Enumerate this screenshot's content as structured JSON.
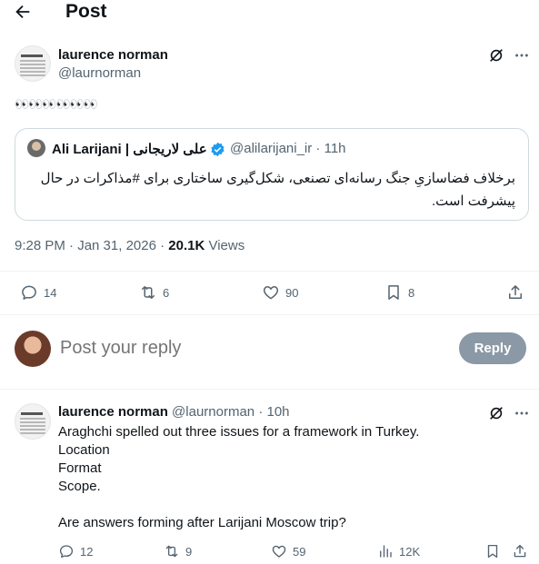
{
  "header": {
    "title": "Post"
  },
  "post": {
    "author_name": "laurence norman",
    "author_handle": "@laurnorman",
    "emoji_text": "👀👀👀👀👀👀",
    "quote": {
      "author_name": "Ali Larijani | علی لاریجانی",
      "author_handle": "@alilarijani_ir · 11h",
      "text": "برخلاف فضاسازیِ جنگ رسانه‌ای تصنعی، شکل‌گیری ساختاری برای #مذاکرات در حال پیشرفت است."
    },
    "timestamp": "9:28 PM · Jan 31, 2026 · ",
    "views_count": "20.1K",
    "views_label": " Views",
    "actions": {
      "replies": "14",
      "reposts": "6",
      "likes": "90",
      "bookmarks": "8"
    }
  },
  "composer": {
    "placeholder": "Post your reply",
    "button_label": "Reply"
  },
  "reply_post": {
    "author_name": "laurence norman",
    "author_handle": "@laurnorman · 10h",
    "lines": [
      "Araghchi spelled out three issues for a framework in Turkey.",
      "Location",
      "Format",
      "Scope.",
      "",
      "Are answers forming after Larijani Moscow trip?"
    ],
    "actions": {
      "replies": "12",
      "reposts": "9",
      "likes": "59",
      "views": "12K"
    }
  },
  "colors": {
    "text": "#0f1419",
    "muted": "#536471",
    "border": "#cfd9de",
    "verified": "#1d9bf0",
    "reply_button": "#8b98a5"
  }
}
